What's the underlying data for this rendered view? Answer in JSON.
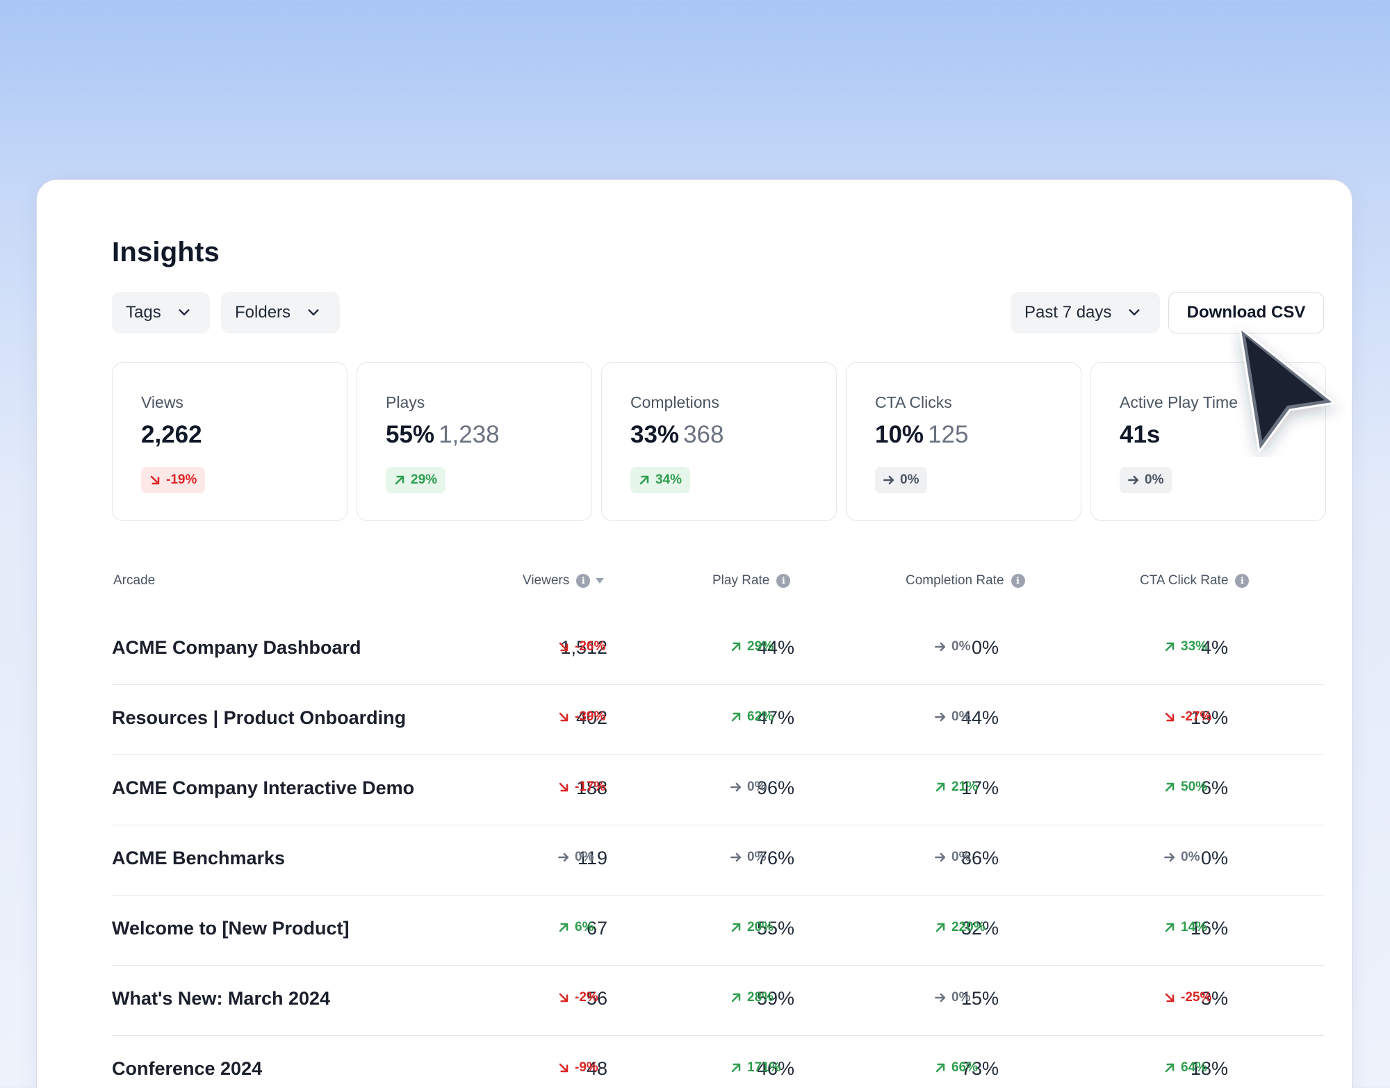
{
  "page": {
    "title": "Insights"
  },
  "filters": {
    "tags_label": "Tags",
    "folders_label": "Folders",
    "range_label": "Past 7 days",
    "download_label": "Download CSV"
  },
  "metrics": [
    {
      "label": "Views",
      "value": "2,262",
      "sub": "",
      "change": "-19%",
      "trend": "down"
    },
    {
      "label": "Plays",
      "value": "55%",
      "sub": "1,238",
      "change": "29%",
      "trend": "up"
    },
    {
      "label": "Completions",
      "value": "33%",
      "sub": "368",
      "change": "34%",
      "trend": "up"
    },
    {
      "label": "CTA Clicks",
      "value": "10%",
      "sub": "125",
      "change": "0%",
      "trend": "flat"
    },
    {
      "label": "Active Play Time",
      "value": "41s",
      "sub": "",
      "change": "0%",
      "trend": "flat"
    }
  ],
  "table": {
    "headers": {
      "arcade": "Arcade",
      "viewers": "Viewers",
      "play_rate": "Play Rate",
      "completion_rate": "Completion Rate",
      "cta_click_rate": "CTA Click Rate"
    },
    "rows": [
      {
        "name": "ACME Company Dashboard",
        "viewers": "1,512",
        "viewers_chg": "-26%",
        "viewers_trend": "down",
        "play": "44%",
        "play_chg": "29%",
        "play_trend": "up",
        "comp": "0%",
        "comp_chg": "0%",
        "comp_trend": "flat",
        "cta": "4%",
        "cta_chg": "33%",
        "cta_trend": "up"
      },
      {
        "name": "Resources | Product Onboarding",
        "viewers": "402",
        "viewers_chg": "-39%",
        "viewers_trend": "down",
        "play": "47%",
        "play_chg": "62%",
        "play_trend": "up",
        "comp": "44%",
        "comp_chg": "0%",
        "comp_trend": "flat",
        "cta": "19%",
        "cta_chg": "-27%",
        "cta_trend": "down"
      },
      {
        "name": "ACME Company Interactive Demo",
        "viewers": "188",
        "viewers_chg": "-17%",
        "viewers_trend": "down",
        "play": "96%",
        "play_chg": "0%",
        "play_trend": "flat",
        "comp": "17%",
        "comp_chg": "21%",
        "comp_trend": "up",
        "cta": "6%",
        "cta_chg": "50%",
        "cta_trend": "up"
      },
      {
        "name": "ACME Benchmarks",
        "viewers": "119",
        "viewers_chg": "0%",
        "viewers_trend": "flat",
        "play": "76%",
        "play_chg": "0%",
        "play_trend": "flat",
        "comp": "86%",
        "comp_chg": "0%",
        "comp_trend": "flat",
        "cta": "0%",
        "cta_chg": "0%",
        "cta_trend": "flat"
      },
      {
        "name": "Welcome to [New Product]",
        "viewers": "67",
        "viewers_chg": "6%",
        "viewers_trend": "up",
        "play": "55%",
        "play_chg": "20%",
        "play_trend": "up",
        "comp": "32%",
        "comp_chg": "220%",
        "comp_trend": "up",
        "cta": "16%",
        "cta_chg": "14%",
        "cta_trend": "up"
      },
      {
        "name": "What's New: March 2024",
        "viewers": "56",
        "viewers_chg": "-2%",
        "viewers_trend": "down",
        "play": "59%",
        "play_chg": "28%",
        "play_trend": "up",
        "comp": "15%",
        "comp_chg": "0%",
        "comp_trend": "flat",
        "cta": "3%",
        "cta_chg": "-25%",
        "cta_trend": "down"
      },
      {
        "name": "Conference 2024",
        "viewers": "48",
        "viewers_chg": "-9%",
        "viewers_trend": "down",
        "play": "46%",
        "play_chg": "171%",
        "play_trend": "up",
        "comp": "73%",
        "comp_chg": "66%",
        "comp_trend": "up",
        "cta": "18%",
        "cta_chg": "64%",
        "cta_trend": "up"
      }
    ]
  },
  "icons": {
    "trend_down": "arrow-down-right-icon",
    "trend_up": "arrow-up-right-icon",
    "trend_flat": "arrow-right-icon",
    "dropdown": "chevron-down-icon",
    "info": "info-icon",
    "sort": "sort-desc-icon",
    "cursor": "mouse-pointer-icon"
  },
  "colors": {
    "down": "#dc2626",
    "up": "#2f9e4f",
    "flat": "#6b7280"
  }
}
